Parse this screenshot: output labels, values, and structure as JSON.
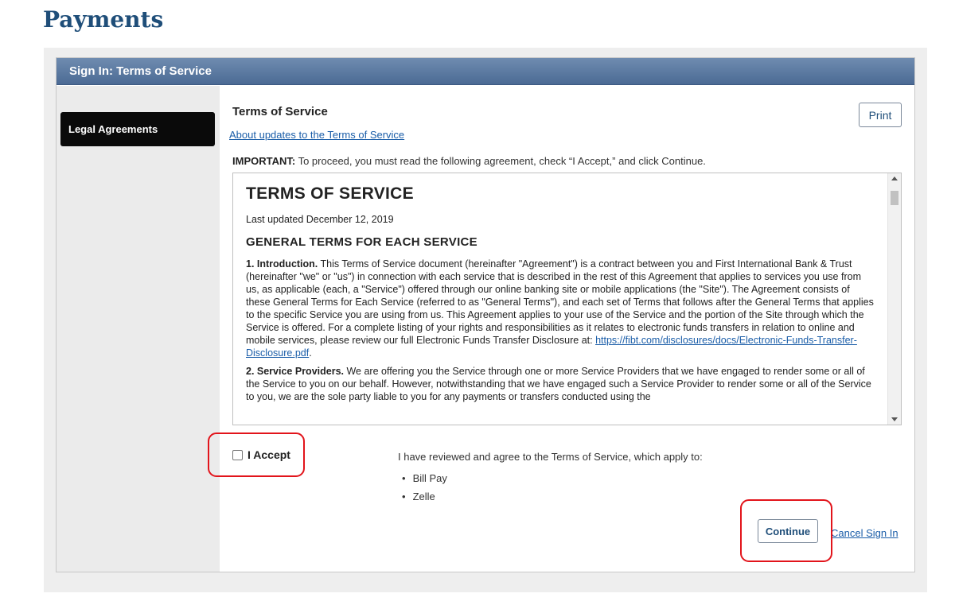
{
  "page": {
    "title": "Payments"
  },
  "panel": {
    "header": "Sign In: Terms of Service"
  },
  "sidebar": {
    "items": [
      {
        "label": "Legal Agreements",
        "active": true
      }
    ]
  },
  "content": {
    "heading": "Terms of Service",
    "updates_link": "About updates to the Terms of Service",
    "print_label": "Print",
    "important_label": "IMPORTANT:",
    "important_text": " To proceed, you must read the following agreement, check “I Accept,” and click Continue."
  },
  "tos": {
    "title": "TERMS OF SERVICE",
    "last_updated": "Last updated December 12, 2019",
    "section_heading": "GENERAL TERMS FOR EACH SERVICE",
    "s1_label": "1. Introduction.",
    "s1_text": " This Terms of Service document (hereinafter \"Agreement\") is a contract between you and First International Bank & Trust (hereinafter \"we\" or \"us\") in connection with each service that is described in the rest of this Agreement that applies to services you use from us, as applicable (each, a \"Service\") offered through our online banking site or mobile applications (the \"Site\"). The Agreement consists of these General Terms for Each Service (referred to as \"General Terms\"), and each set of Terms that follows after the General Terms that applies to the specific Service you are using from us. This Agreement applies to your use of the Service and the portion of the Site through which the Service is offered. For a complete listing of your rights and responsibilities as it relates to electronic funds transfers in relation to online and mobile services, please review our full Electronic Funds Transfer Disclosure at: ",
    "s1_link": "https://fibt.com/disclosures/docs/Electronic-Funds-Transfer-Disclosure.pdf",
    "s1_end": ".",
    "s2_label": "2. Service Providers.",
    "s2_text": " We are offering you the Service through one or more Service Providers that we have engaged to render some or all of the Service to you on our behalf. However, notwithstanding that we have engaged such a Service Provider to render some or all of the Service to you, we are the sole party liable to you for any payments or transfers conducted using the"
  },
  "accept": {
    "label": "I Accept",
    "checked": false
  },
  "agreement": {
    "text": "I have reviewed and agree to the Terms of Service, which apply to:",
    "services": [
      "Bill Pay",
      "Zelle"
    ]
  },
  "actions": {
    "continue_label": "Continue",
    "cancel_label": "Cancel Sign In"
  },
  "colors": {
    "title": "#1f4e79",
    "header": "#4b6a94",
    "link": "#1a5da8",
    "highlight": "#e2141b"
  }
}
